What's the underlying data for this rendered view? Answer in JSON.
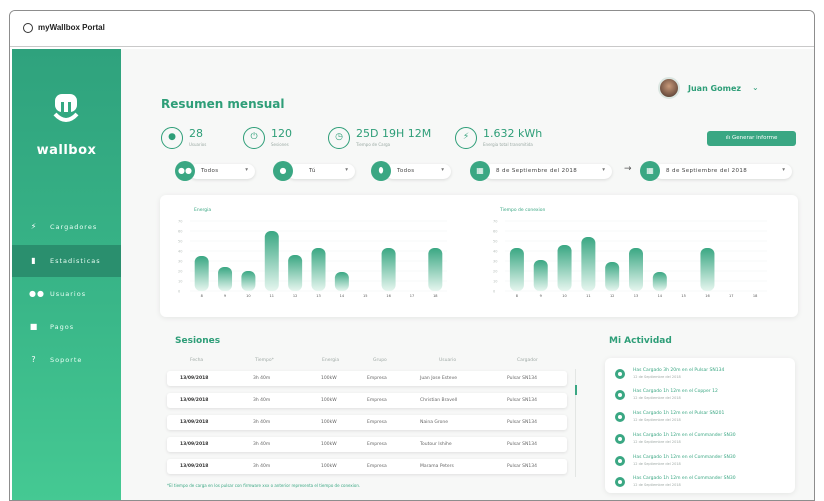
{
  "window": {
    "title": "myWallbox Portal"
  },
  "sidebar": {
    "logo_text": "wallbox",
    "items": [
      {
        "label": "Cargadores",
        "icon": "bolt-icon"
      },
      {
        "label": "Estadisticas",
        "icon": "bar-chart-icon",
        "active": true
      },
      {
        "label": "Usuarios",
        "icon": "users-icon"
      },
      {
        "label": "Pagos",
        "icon": "wallet-icon"
      },
      {
        "label": "Soporte",
        "icon": "help-icon"
      }
    ]
  },
  "header": {
    "title": "Resumen mensual",
    "user_name": "Juan Gomez"
  },
  "stats": [
    {
      "value": "28",
      "label": "Usuarios",
      "icon": "user-icon"
    },
    {
      "value": "120",
      "label": "Sesiones",
      "icon": "plug-icon"
    },
    {
      "value": "25D 19H 12M",
      "label": "Tiempo de Carga",
      "icon": "clock-icon"
    },
    {
      "value": "1.632 kWh",
      "label": "Energia total transmitida",
      "icon": "energy-icon"
    }
  ],
  "report_button": "Generar informe",
  "filters": [
    {
      "value": "Todos",
      "icon": "users-icon"
    },
    {
      "value": "Tú",
      "icon": "user-icon"
    },
    {
      "value": "Todos",
      "icon": "charger-icon"
    },
    {
      "value": "8 de Septiembre del 2018",
      "icon": "calendar-icon"
    },
    {
      "value": "8 de Septiembre del 2018",
      "icon": "calendar-icon"
    }
  ],
  "chart_data": [
    {
      "type": "bar",
      "title": "Energia",
      "categories": [
        "8",
        "9",
        "10",
        "11",
        "12",
        "13",
        "14",
        "15",
        "16",
        "17",
        "18"
      ],
      "values": [
        35,
        24,
        20,
        60,
        36,
        43,
        19,
        0,
        43,
        0,
        43
      ],
      "ylim": [
        0,
        70
      ],
      "yticks": [
        "70",
        "60",
        "50",
        "40",
        "30",
        "20",
        "10",
        "0"
      ]
    },
    {
      "type": "bar",
      "title": "Tiempo de conexion",
      "categories": [
        "8",
        "9",
        "10",
        "11",
        "12",
        "13",
        "14",
        "15",
        "16",
        "17",
        "18"
      ],
      "values": [
        43,
        31,
        46,
        54,
        29,
        43,
        19,
        0,
        43,
        0,
        0
      ],
      "ylim": [
        0,
        70
      ],
      "yticks": [
        "70",
        "60",
        "50",
        "40",
        "30",
        "20",
        "10",
        "0"
      ]
    }
  ],
  "sessions": {
    "title": "Sesiones",
    "columns": [
      "Fecha",
      "Tiempo*",
      "Energia",
      "Grupo",
      "Usuario",
      "Cargador"
    ],
    "rows": [
      [
        "13/09/2018",
        "3h 40m",
        "100kW",
        "Empresa",
        "Juan Jose Esteve",
        "Pulsar SN134"
      ],
      [
        "13/09/2018",
        "3h 40m",
        "100kW",
        "Empresa",
        "Christian Bravell",
        "Pulsar SN134"
      ],
      [
        "13/09/2018",
        "3h 40m",
        "100kW",
        "Empresa",
        "Naina Grone",
        "Pulsar SN134"
      ],
      [
        "13/09/2018",
        "3h 40m",
        "100kW",
        "Empresa",
        "Toutour Ishihe",
        "Pulsar SN134"
      ],
      [
        "13/09/2018",
        "3h 40m",
        "100kW",
        "Empresa",
        "Marama Peters",
        "Pulsar SN134"
      ]
    ],
    "footnote": "*El tiempo de carga en los pulsar con firmware xxx o anterior representa el tiempo de conexion."
  },
  "activity": {
    "title": "Mi Actividad",
    "items": [
      {
        "text": "Has Cargado 3h 20m en el Pulsar SN134",
        "date": "12 de Septiembre del 2018"
      },
      {
        "text": "Has Cargado 1h 12m en el Copper 12",
        "date": "12 de Septiembre del 2018"
      },
      {
        "text": "Has Cargado 1h 12m en el Pulsar SN201",
        "date": "12 de Septiembre del 2018"
      },
      {
        "text": "Has Cargado 1h 12m en el Commander SN30",
        "date": "12 de Septiembre del 2018"
      },
      {
        "text": "Has Cargado 1h 12m en el Commander SN30",
        "date": "12 de Septiembre del 2018"
      },
      {
        "text": "Has Cargado 1h 12m en el Commander SN30",
        "date": "12 de Septiembre del 2018"
      }
    ]
  },
  "colors": {
    "accent": "#3aa783",
    "sidebar": "#39b688",
    "bar_top": "#3aa783",
    "bar_bottom": "#e6f6ef"
  }
}
